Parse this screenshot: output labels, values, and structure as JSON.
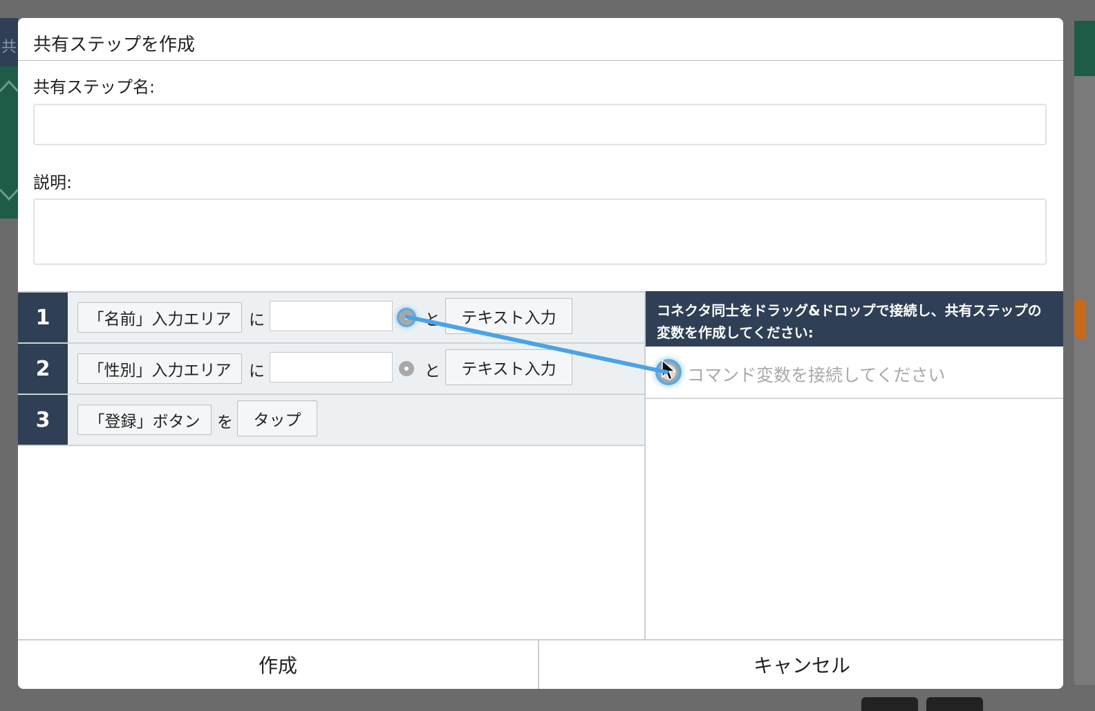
{
  "background": {
    "left_header_glyph": "共"
  },
  "dialog": {
    "title": "共有ステップを作成",
    "name_label": "共有ステップ名:",
    "name_value": "",
    "description_label": "説明:",
    "description_value": ""
  },
  "steps": [
    {
      "number": "1",
      "target": "「名前」入力エリア",
      "particle1": "に",
      "value": "",
      "particle2": "と",
      "command": "テキスト入力"
    },
    {
      "number": "2",
      "target": "「性別」入力エリア",
      "particle1": "に",
      "value": "",
      "particle2": "と",
      "command": "テキスト入力"
    },
    {
      "number": "3",
      "target": "「登録」ボタン",
      "particle1": "を",
      "command": "タップ"
    }
  ],
  "variables_panel": {
    "instruction": "コネクタ同士をドラッグ&ドロップで接続し、共有ステップの変数を作成してください:",
    "placeholder": "コマンド変数を接続してください"
  },
  "footer": {
    "create_label": "作成",
    "cancel_label": "キャンセル"
  },
  "colors": {
    "header_navy": "#2f3f55",
    "connector_highlight": "#5aa9e6",
    "drag_line": "#4aa3e8"
  },
  "icons": [
    "connector-dot-icon",
    "mouse-cursor-icon",
    "chevron-up-icon",
    "chevron-down-icon"
  ]
}
